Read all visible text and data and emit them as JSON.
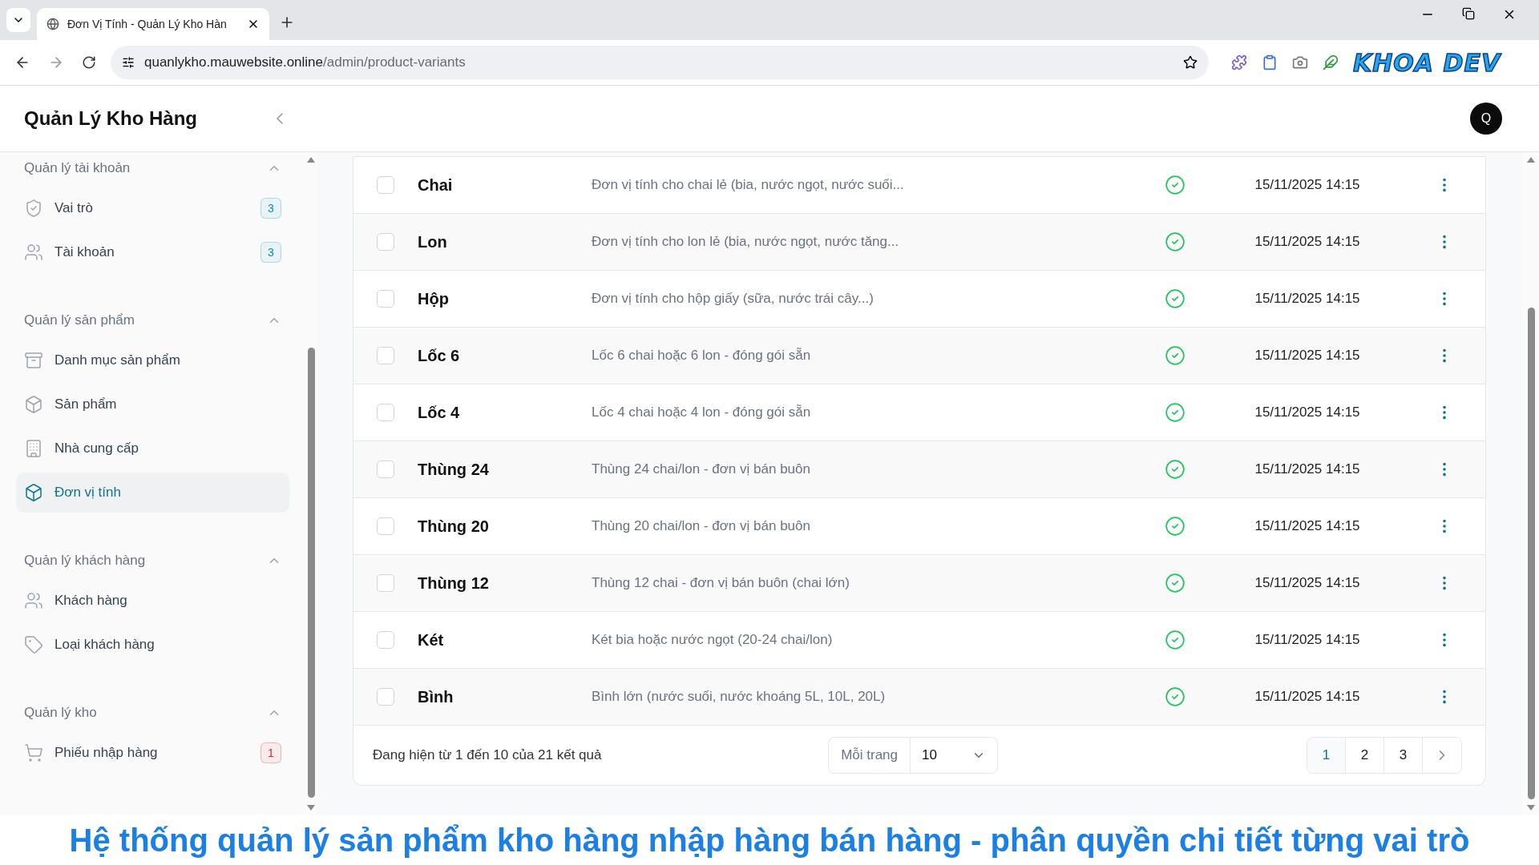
{
  "browser": {
    "tab_title": "Đơn Vị Tính - Quản Lý Kho Hàn",
    "url_domain": "quanlykho.mauwebsite.online",
    "url_path": "/admin/product-variants",
    "logo": "KHOA DEV"
  },
  "app": {
    "brand": "Quản Lý Kho Hàng",
    "avatar": "Q"
  },
  "sidebar": {
    "sections": [
      {
        "title": "Quản lý tài khoản",
        "expanded": true,
        "items": [
          {
            "label": "Vai trò",
            "kind": "shield",
            "selected": false,
            "badge": "3",
            "color": "#0891b2"
          },
          {
            "label": "Tài khoản",
            "kind": "users",
            "selected": false,
            "badge": "3",
            "color": "#0891b2"
          }
        ]
      },
      {
        "title": "Quản lý sản phẩm",
        "expanded": true,
        "items": [
          {
            "label": "Danh mục sản phẩm",
            "kind": "archive",
            "selected": false
          },
          {
            "label": "Sản phẩm",
            "kind": "box",
            "selected": false
          },
          {
            "label": "Nhà cung cấp",
            "kind": "building",
            "selected": false
          },
          {
            "label": "Đơn vị tính",
            "kind": "box",
            "selected": true
          }
        ]
      },
      {
        "title": "Quản lý khách hàng",
        "expanded": true,
        "items": [
          {
            "label": "Khách hàng",
            "kind": "users",
            "selected": false
          },
          {
            "label": "Loại khách hàng",
            "kind": "tag",
            "selected": false
          }
        ]
      },
      {
        "title": "Quản lý kho",
        "expanded": true,
        "items": [
          {
            "label": "Phiếu nhập hàng",
            "kind": "cart",
            "selected": false,
            "badge": "1",
            "color": "#dc2626"
          }
        ]
      }
    ]
  },
  "table": {
    "rows": [
      {
        "checked": false,
        "name": "Chai",
        "description": "Đơn vị tính cho chai lẻ (bia, nước ngọt, nước suối...",
        "active": true,
        "date": "15/11/2025 14:15"
      },
      {
        "checked": false,
        "name": "Lon",
        "description": "Đơn vị tính cho lon lẻ (bia, nước ngọt, nước tăng...",
        "active": true,
        "date": "15/11/2025 14:15"
      },
      {
        "checked": false,
        "name": "Hộp",
        "description": "Đơn vị tính cho hộp giấy (sữa, nước trái cây...)",
        "active": true,
        "date": "15/11/2025 14:15"
      },
      {
        "checked": false,
        "name": "Lốc 6",
        "description": "Lốc 6 chai hoặc 6 lon - đóng gói sẵn",
        "active": true,
        "date": "15/11/2025 14:15"
      },
      {
        "checked": false,
        "name": "Lốc 4",
        "description": "Lốc 4 chai hoặc 4 lon - đóng gói sẵn",
        "active": true,
        "date": "15/11/2025 14:15"
      },
      {
        "checked": false,
        "name": "Thùng 24",
        "description": "Thùng 24 chai/lon - đơn vị bán buôn",
        "active": true,
        "date": "15/11/2025 14:15"
      },
      {
        "checked": false,
        "name": "Thùng 20",
        "description": "Thùng 20 chai/lon - đơn vị bán buôn",
        "active": true,
        "date": "15/11/2025 14:15"
      },
      {
        "checked": false,
        "name": "Thùng 12",
        "description": "Thùng 12 chai - đơn vị bán buôn (chai lớn)",
        "active": true,
        "date": "15/11/2025 14:15"
      },
      {
        "checked": false,
        "name": "Két",
        "description": "Két bia hoặc nước ngọt (20-24 chai/lon)",
        "active": true,
        "date": "15/11/2025 14:15"
      },
      {
        "checked": false,
        "name": "Bình",
        "description": "Bình lớn (nước suối, nước khoáng 5L, 10L, 20L)",
        "active": true,
        "date": "15/11/2025 14:15"
      }
    ]
  },
  "pagination": {
    "summary": "Đang hiện từ 1 đến 10 của 21 kết quả",
    "per_page_label": "Mỗi trang",
    "per_page": "10",
    "pages": [
      {
        "label": "1",
        "selected": true
      },
      {
        "label": "2",
        "selected": false
      },
      {
        "label": "3",
        "selected": false
      }
    ]
  },
  "caption": "Hệ thống quản lý sản phẩm kho hàng nhập hàng bán hàng - phân quyền chi tiết từng vai trò"
}
